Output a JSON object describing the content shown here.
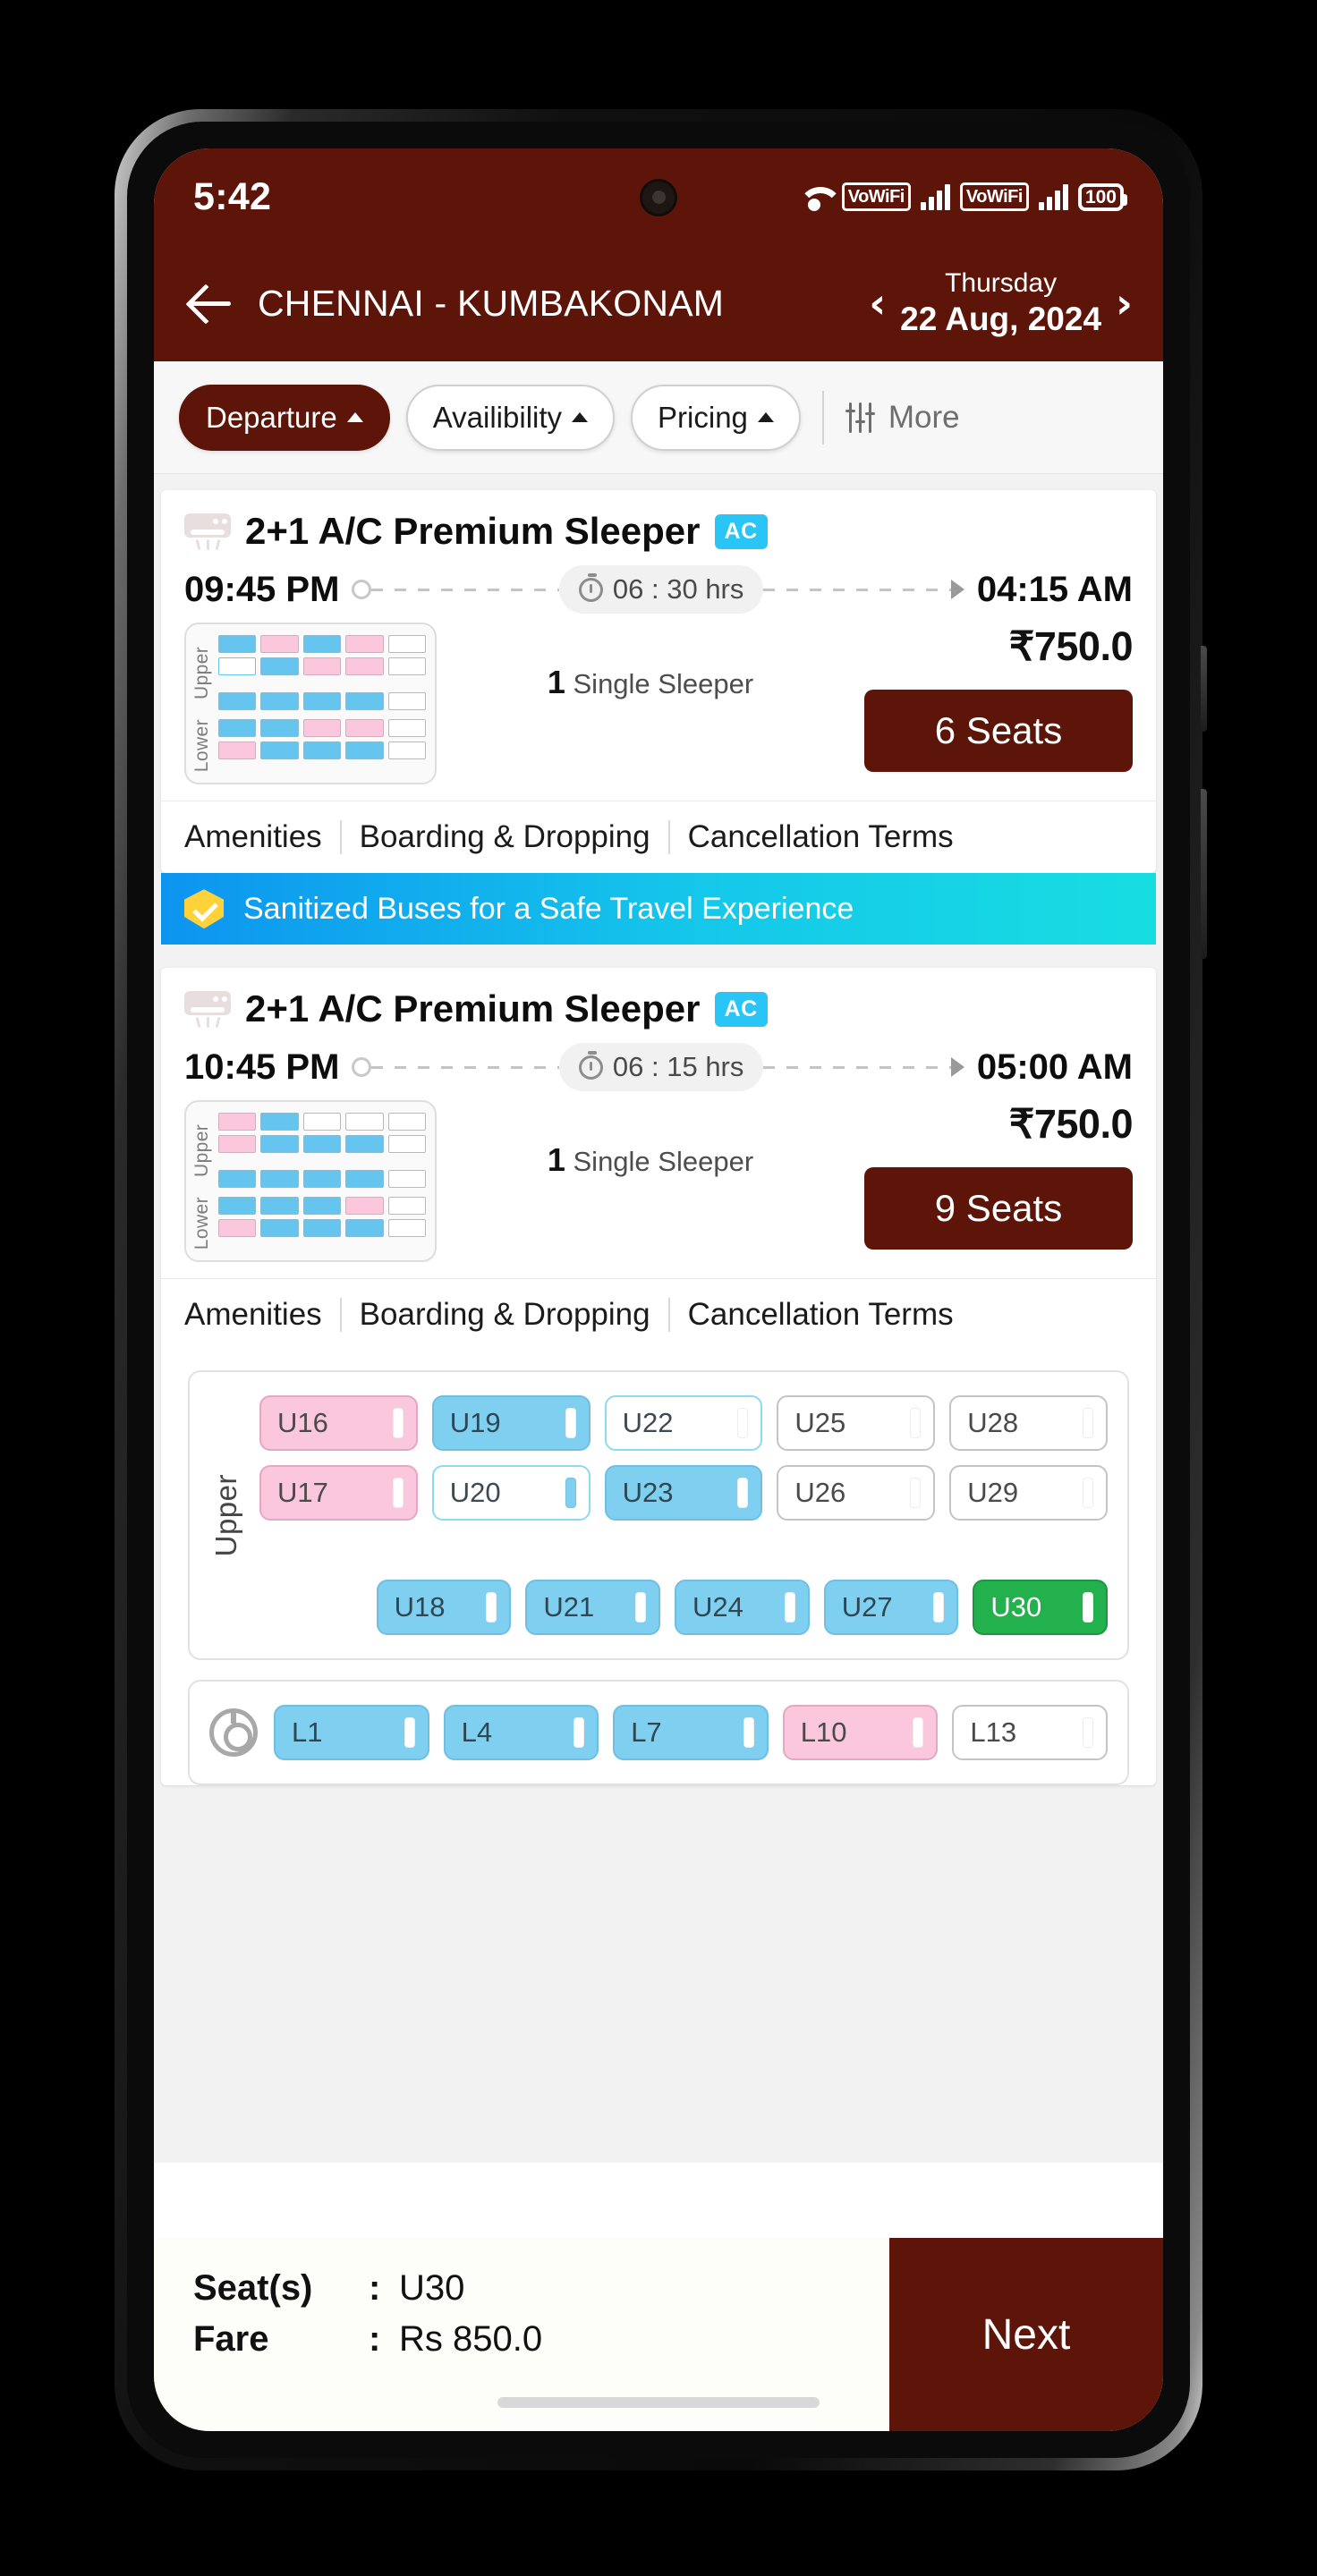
{
  "status_bar": {
    "time": "5:42",
    "wifi_icon": "wifi-icon",
    "vowifi_1": "VoWiFi",
    "vowifi_2": "VoWiFi",
    "battery_level": "100"
  },
  "app_bar": {
    "back_icon": "back-arrow-icon",
    "route": "CHENNAI - KUMBAKONAM",
    "prev_icon": "chevron-left-icon",
    "day": "Thursday",
    "date": "22 Aug, 2024",
    "next_icon": "chevron-right-icon"
  },
  "filters": {
    "chips": [
      {
        "label": "Departure",
        "active": true
      },
      {
        "label": "Availibility",
        "active": false
      },
      {
        "label": "Pricing",
        "active": false
      }
    ],
    "more_label": "More",
    "more_icon": "tune-icon"
  },
  "buses": [
    {
      "name": "2+1 A/C Premium Sleeper",
      "badge": "AC",
      "depart": "09:45 PM",
      "duration": "06 : 30 hrs",
      "arrive": "04:15 AM",
      "price": "₹750.0",
      "seat_count_qty": "1",
      "seat_count_label": "Single Sleeper",
      "seats_button": "6 Seats",
      "links": [
        "Amenities",
        "Boarding & Dropping",
        "Cancellation Terms"
      ],
      "mini_map": {
        "upper_label": "Upper",
        "lower_label": "Lower",
        "upper_rows": [
          [
            "blue",
            "pink",
            "blue",
            "pink",
            "white"
          ],
          [
            "sel",
            "blue",
            "pink",
            "pink",
            "white"
          ],
          [
            "blue",
            "blue",
            "blue",
            "blue",
            "white"
          ]
        ],
        "lower_rows": [
          [
            "blue",
            "blue",
            "pink",
            "pink",
            "white"
          ],
          [
            "pink",
            "blue",
            "blue",
            "blue",
            "white"
          ]
        ]
      }
    },
    {
      "name": "2+1 A/C Premium Sleeper",
      "badge": "AC",
      "depart": "10:45 PM",
      "duration": "06 : 15 hrs",
      "arrive": "05:00 AM",
      "price": "₹750.0",
      "seat_count_qty": "1",
      "seat_count_label": "Single Sleeper",
      "seats_button": "9 Seats",
      "links": [
        "Amenities",
        "Boarding & Dropping",
        "Cancellation Terms"
      ],
      "mini_map": {
        "upper_label": "Upper",
        "lower_label": "Lower",
        "upper_rows": [
          [
            "pink",
            "blue",
            "white",
            "white",
            "white"
          ],
          [
            "pink",
            "blue",
            "blue",
            "blue",
            "white"
          ],
          [
            "blue",
            "blue",
            "blue",
            "blue",
            "white"
          ]
        ],
        "lower_rows": [
          [
            "blue",
            "blue",
            "blue",
            "pink",
            "white"
          ],
          [
            "pink",
            "blue",
            "blue",
            "blue",
            "white"
          ]
        ]
      }
    }
  ],
  "banner": {
    "icon": "shield-check-icon",
    "text": "Sanitized Buses for a Safe Travel Experience"
  },
  "seat_layout": {
    "upper_deck": {
      "label": "Upper",
      "rows": [
        [
          {
            "id": "U16",
            "state": "booked-f"
          },
          {
            "id": "U19",
            "state": "avail-m"
          },
          {
            "id": "U22",
            "state": "avail"
          },
          {
            "id": "U25",
            "state": "free"
          },
          {
            "id": "U28",
            "state": "free"
          }
        ],
        [
          {
            "id": "U17",
            "state": "booked-f"
          },
          {
            "id": "U20",
            "state": "avail"
          },
          {
            "id": "U23",
            "state": "avail-m"
          },
          {
            "id": "U26",
            "state": "free"
          },
          {
            "id": "U29",
            "state": "free"
          }
        ],
        [
          {
            "id": "",
            "state": "spacer"
          },
          {
            "id": "U18",
            "state": "avail-m"
          },
          {
            "id": "U21",
            "state": "avail-m"
          },
          {
            "id": "U24",
            "state": "avail-m"
          },
          {
            "id": "U27",
            "state": "avail-m"
          },
          {
            "id": "U30",
            "state": "selected"
          }
        ]
      ]
    },
    "lower_deck": {
      "icon": "steering-wheel-icon",
      "rows": [
        [
          {
            "id": "L1",
            "state": "avail-m"
          },
          {
            "id": "L4",
            "state": "avail-m"
          },
          {
            "id": "L7",
            "state": "avail-m"
          },
          {
            "id": "L10",
            "state": "booked-f"
          },
          {
            "id": "L13",
            "state": "free"
          }
        ]
      ]
    }
  },
  "bottom_bar": {
    "seat_key": "Seat(s)",
    "seat_colon": ":",
    "seat_value": "U30",
    "fare_key": "Fare",
    "fare_colon": ":",
    "fare_value": "Rs 850.0",
    "next_label": "Next"
  },
  "colors": {
    "brand": "#5e1509",
    "accent_blue": "#29c5f6",
    "selected_green": "#22b14c",
    "female_pink": "#fbc7dd",
    "male_blue": "#7fd0f0"
  }
}
